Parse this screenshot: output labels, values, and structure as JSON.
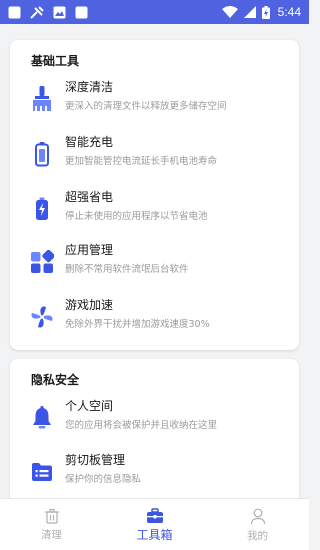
{
  "status_bar": {
    "time": "5:44"
  },
  "sections": [
    {
      "title": "基础工具",
      "items": [
        {
          "name": "深度清洁",
          "desc": "更深入的清理文件以释放更多储存空间",
          "icon": "broom-icon"
        },
        {
          "name": "智能充电",
          "desc": "更加智能管控电流延长手机电池寿命",
          "icon": "battery-icon"
        },
        {
          "name": "超强省电",
          "desc": "停止未使用的应用程序以节省电池",
          "icon": "battery-saver-icon"
        },
        {
          "name": "应用管理",
          "desc": "删除不常用软件流氓后台软件",
          "icon": "apps-grid-icon"
        },
        {
          "name": "游戏加速",
          "desc": "免除外界干扰并增加游戏速度30%",
          "icon": "pinwheel-icon"
        }
      ]
    },
    {
      "title": "隐私安全",
      "items": [
        {
          "name": "个人空间",
          "desc": "您的应用将会被保护并且收纳在这里",
          "icon": "bell-icon"
        },
        {
          "name": "剪切板管理",
          "desc": "保护你的信息隐私",
          "icon": "folder-list-icon"
        }
      ]
    }
  ],
  "tabs": [
    {
      "label": "清理",
      "icon": "trash-icon",
      "active": false
    },
    {
      "label": "工具箱",
      "icon": "toolbox-icon",
      "active": true
    },
    {
      "label": "我的",
      "icon": "user-icon",
      "active": false
    }
  ],
  "colors": {
    "accent": "#3b55e6",
    "status_bar": "#4f62e0",
    "inactive": "#b0b0b0"
  }
}
